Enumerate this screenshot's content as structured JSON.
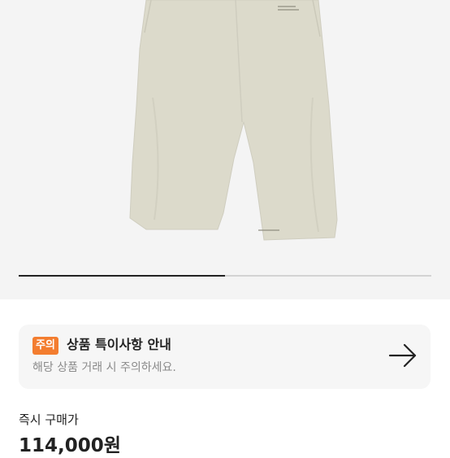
{
  "gallery": {
    "product_image_icon": "pants-product-photo",
    "image_count": 2,
    "current_index": 1,
    "progress_fraction": 0.5
  },
  "notice": {
    "badge": "주의",
    "title": "상품 특이사항 안내",
    "description": "해당 상품 거래 시 주의하세요.",
    "arrow_icon": "arrow-right-icon",
    "badge_color": "#f37d2f"
  },
  "price": {
    "label": "즉시 구매가",
    "value": "114,000원"
  }
}
